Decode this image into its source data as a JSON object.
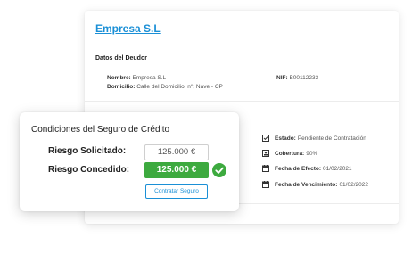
{
  "company": {
    "name": "Empresa S.L"
  },
  "debtor": {
    "section_title": "Datos del Deudor",
    "name_label": "Nombre:",
    "name_value": "Empresa S.L",
    "address_label": "Domicilio:",
    "address_value": "Calle del Domicilio, nº, Nave - CP",
    "nif_label": "NIF:",
    "nif_value": "B00112233"
  },
  "status_panel": {
    "items": [
      {
        "icon": "edit-check-icon",
        "label": "Estado:",
        "value": "Pendiente de Contratación"
      },
      {
        "icon": "shield-doc-icon",
        "label": "Cobertura:",
        "value": "90%"
      },
      {
        "icon": "calendar-icon",
        "label": "Fecha de Efecto:",
        "value": "01/02/2021"
      },
      {
        "icon": "calendar-icon",
        "label": "Fecha de Vencimiento:",
        "value": "01/02/2022"
      }
    ]
  },
  "insurance": {
    "title": "Condiciones del Seguro de Crédito",
    "requested_label": "Riesgo Solicitado:",
    "requested_value": "125.000 €",
    "granted_label": "Riesgo Concedido:",
    "granted_value": "125.000 €",
    "button_label": "Contratar Seguro"
  },
  "colors": {
    "accent": "#1a8fd6",
    "success": "#3daa3f"
  }
}
